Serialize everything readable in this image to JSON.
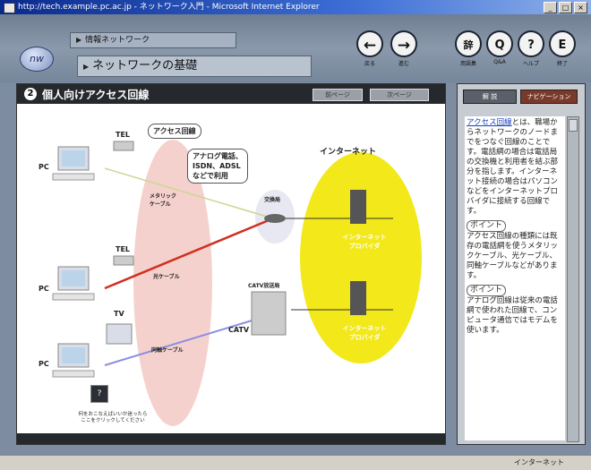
{
  "window": {
    "title": "http://tech.example.pc.ac.jp - ネットワーク入門 - Microsoft Internet Explorer",
    "buttons": [
      "_",
      "□",
      "×"
    ]
  },
  "header": {
    "logo_text": "nw",
    "breadcrumb_top": "情報ネットワーク",
    "breadcrumb_page": "ネットワークの基礎",
    "nav": [
      {
        "icon": "back-arrow-icon",
        "glyph": "←",
        "label": "戻る"
      },
      {
        "icon": "forward-arrow-icon",
        "glyph": "→",
        "label": "進む"
      },
      {
        "icon": "glossary-icon",
        "glyph": "辞",
        "label": "用語集"
      },
      {
        "icon": "quiz-icon",
        "glyph": "Q",
        "label": "Q&A"
      },
      {
        "icon": "help-icon",
        "glyph": "?",
        "label": "ヘルプ"
      },
      {
        "icon": "exit-icon",
        "glyph": "E",
        "label": "終了"
      }
    ]
  },
  "section": {
    "number": "2",
    "title": "個人向けアクセス回線",
    "btn_prev": "前ページ",
    "btn_next": "次ページ"
  },
  "diagram": {
    "pc_label": "PC",
    "tel_label": "TEL",
    "tv_label": "TV",
    "access_line_bubble": "アクセス回線",
    "analog_bubble_1": "アナログ電話、",
    "analog_bubble_2": "ISDN、ADSL",
    "analog_bubble_3": "などで利用",
    "internet_label": "インターネット",
    "metallic_cable_1": "メタリック",
    "metallic_cable_2": "ケーブル",
    "optical_cable": "光ケーブル",
    "coax_cable": "同軸ケーブル",
    "exchange_label": "交換局",
    "catv_station": "CATV放送局",
    "catv_label": "CATV",
    "isp_1": "インターネット",
    "isp_2": "プロバイダ",
    "help_text_1": "何をおこなえばいいか迷ったら",
    "help_text_2": "ここをクリックしてください"
  },
  "right_panel": {
    "tab_explain": "解 説",
    "tab_navi": "ナビゲーション",
    "text_link": "アクセス回線",
    "text_1": "とは、職場からネットワークのノードまでをつなぐ回線のことです。電話網の場合は電話局の交換機と利用者を結ぶ部分を指します。インターネット接続の場合はパソコンなどをインターネットプロバイダに接続する回線です。",
    "note1_tag": "ポイント",
    "text_2": "アクセス回線の種類には既存の電話網を使うメタリックケーブル、光ケーブル、同軸ケーブルなどがあります。",
    "note2_tag": "ポイント",
    "text_3": "アナログ回線は従来の電話網で使われた回線で、コンピュータ通信ではモデムを使います。"
  },
  "status": {
    "text": "インターネット"
  },
  "colors": {
    "accent_yellow": "#f2e81a",
    "pink_zone": "#f3c9c4",
    "red_line": "#d03020",
    "blue_line": "#8c8ee0"
  }
}
